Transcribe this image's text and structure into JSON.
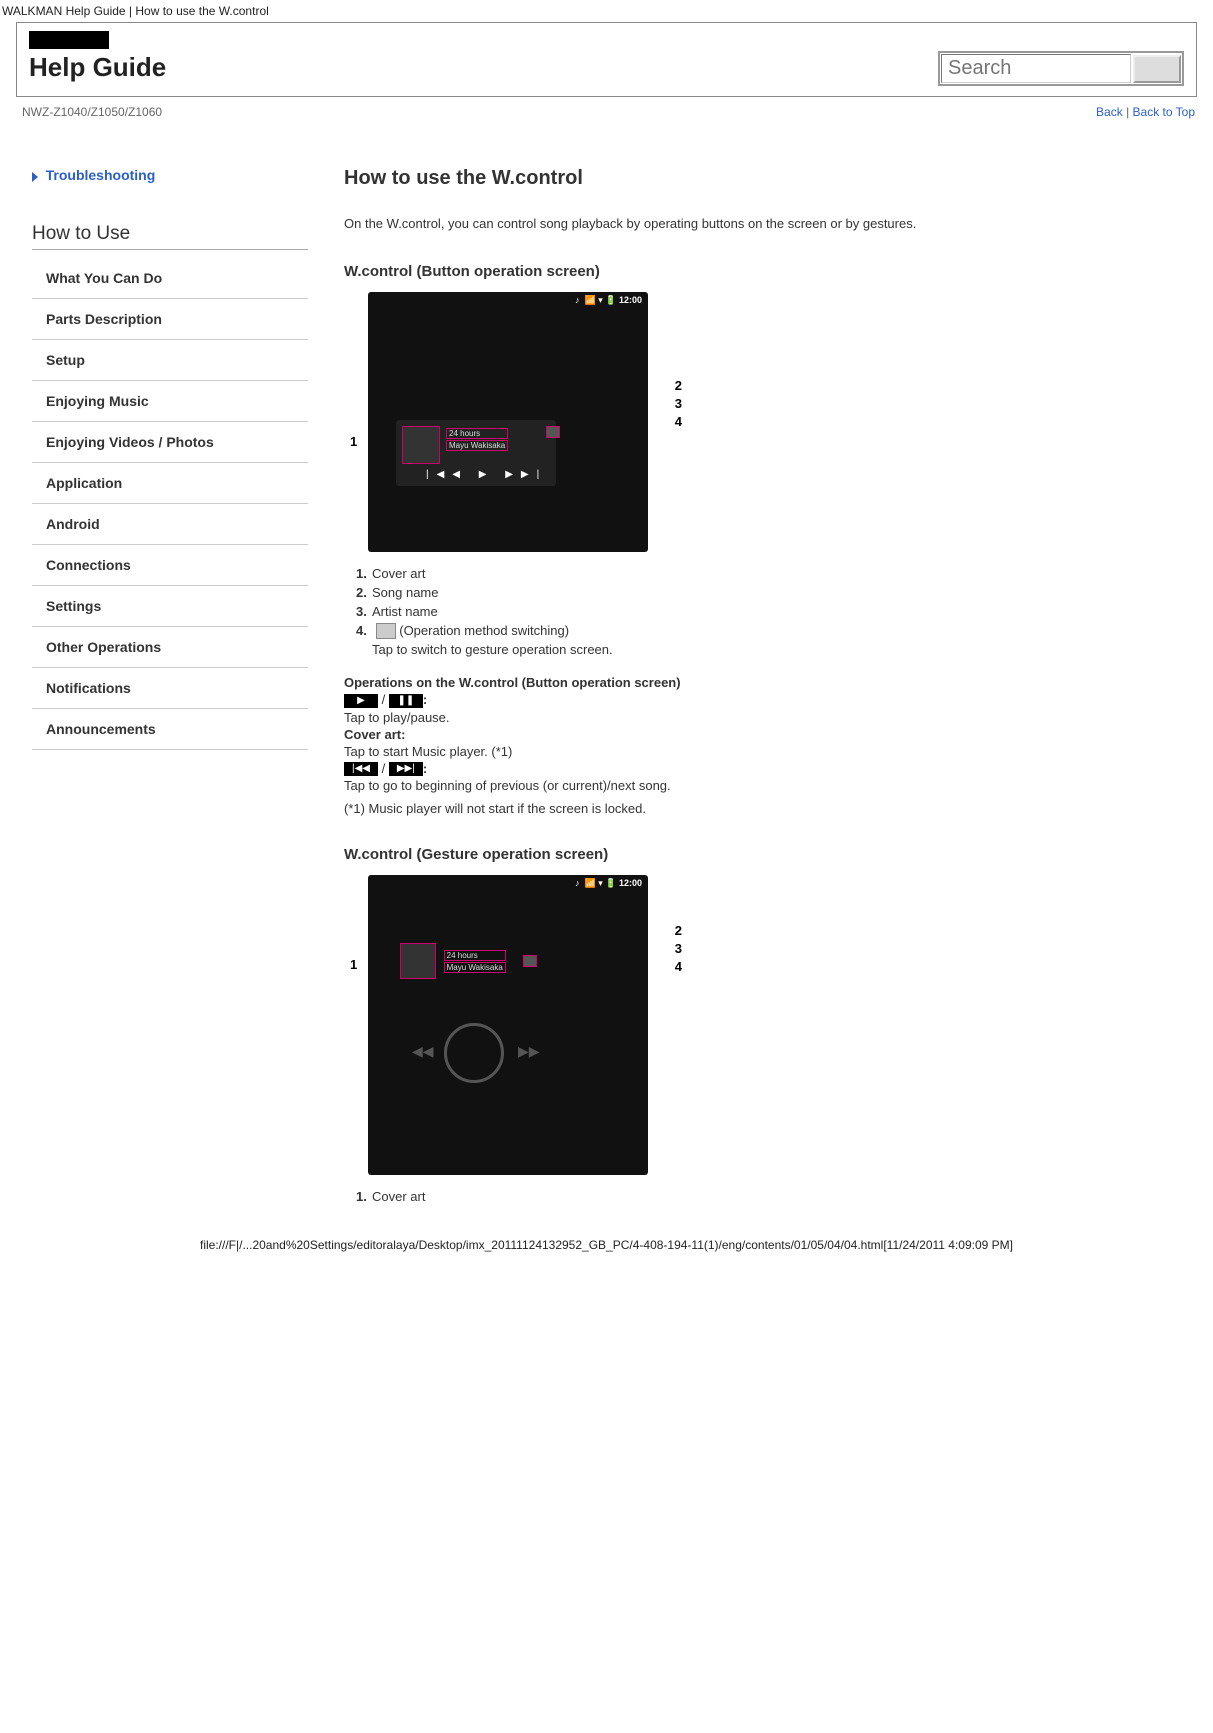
{
  "page": {
    "top_title": "WALKMAN Help Guide | How to use the W.control",
    "help_title": "Help Guide",
    "search_placeholder": "Search",
    "model": "NWZ-Z1040/Z1050/Z1060",
    "back": "Back",
    "back_to_top": "Back to Top",
    "footer": "file:///F|/...20and%20Settings/editoralaya/Desktop/imx_20111124132952_GB_PC/4-408-194-11(1)/eng/contents/01/05/04/04.html[11/24/2011 4:09:09 PM]"
  },
  "sidebar": {
    "troubleshooting": "Troubleshooting",
    "how_to_use": "How to Use",
    "items": [
      {
        "label": "What You Can Do"
      },
      {
        "label": "Parts Description"
      },
      {
        "label": "Setup"
      },
      {
        "label": "Enjoying Music"
      },
      {
        "label": "Enjoying Videos / Photos"
      },
      {
        "label": "Application"
      },
      {
        "label": "Android"
      },
      {
        "label": "Connections"
      },
      {
        "label": "Settings"
      },
      {
        "label": "Other Operations"
      },
      {
        "label": "Notifications"
      },
      {
        "label": "Announcements"
      }
    ]
  },
  "article": {
    "title": "How to use the W.control",
    "intro": "On the W.control, you can control song playback by operating buttons on the screen or by gestures.",
    "sec1_title": "W.control (Button operation screen)",
    "fig1_time": "12:00",
    "fig1_song": "24 hours",
    "fig1_artist": "Mayu Wakisaka",
    "list1": [
      {
        "n": "1.",
        "t": "Cover art"
      },
      {
        "n": "2.",
        "t": "Song name"
      },
      {
        "n": "3.",
        "t": "Artist name"
      }
    ],
    "list1_item4_n": "4.",
    "list1_item4_t": " (Operation method switching)",
    "list1_item4_sub": "Tap to switch to gesture operation screen.",
    "ops1_title": "Operations on the W.control (Button operation screen)",
    "play_icon": "▶",
    "pause_icon": "❚❚",
    "play_colon": ":",
    "play_desc": "Tap to play/pause.",
    "cover_label": "Cover art:",
    "cover_desc": "Tap to start Music player. (*1)",
    "prev_icon": "|◀◀",
    "next_icon": "▶▶|",
    "prevnext_desc": "Tap to go to beginning of previous (or current)/next song.",
    "note1": "(*1) Music player will not start if the screen is locked.",
    "sec2_title": "W.control (Gesture operation screen)",
    "fig2_time": "12:00",
    "fig2_song": "24 hours",
    "fig2_artist": "Mayu Wakisaka",
    "list2": [
      {
        "n": "1.",
        "t": "Cover art"
      }
    ]
  }
}
